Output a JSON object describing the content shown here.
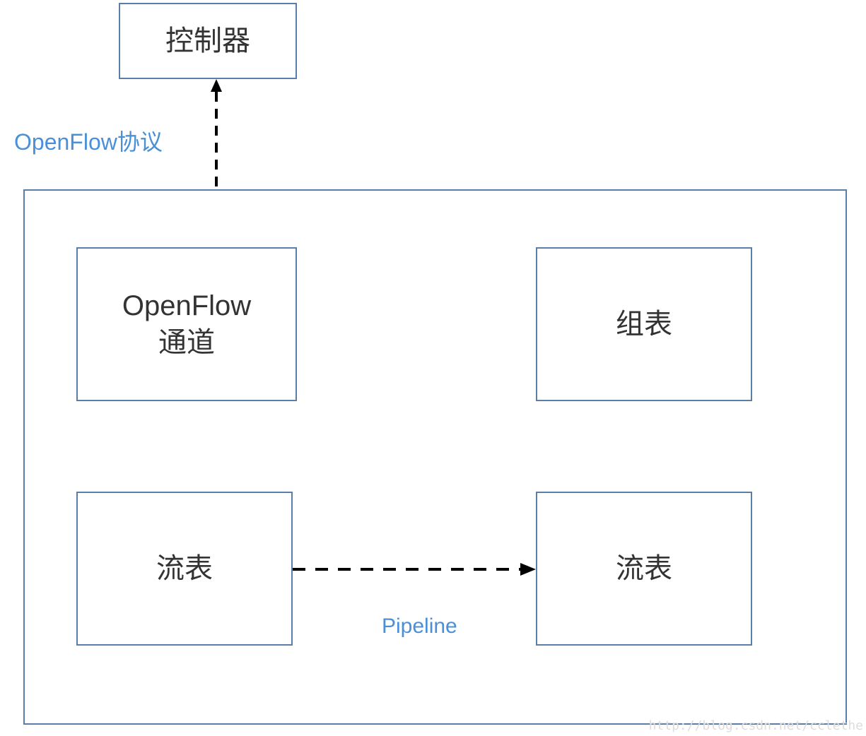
{
  "boxes": {
    "controller": "控制器",
    "channel_line1": "OpenFlow",
    "channel_line2": "通道",
    "group_table": "组表",
    "flow_table_1": "流表",
    "flow_table_2": "流表"
  },
  "labels": {
    "openflow_protocol": "OpenFlow协议",
    "pipeline": "Pipeline"
  },
  "connections": [
    {
      "from": "controller",
      "to": "channel",
      "style": "dashed",
      "direction": "bidirectional",
      "label": "OpenFlow协议"
    },
    {
      "from": "flow_table_1",
      "to": "flow_table_2",
      "style": "dashed",
      "direction": "right",
      "label": "Pipeline"
    }
  ],
  "watermark": "http://blog.csdn.net/cclethe"
}
